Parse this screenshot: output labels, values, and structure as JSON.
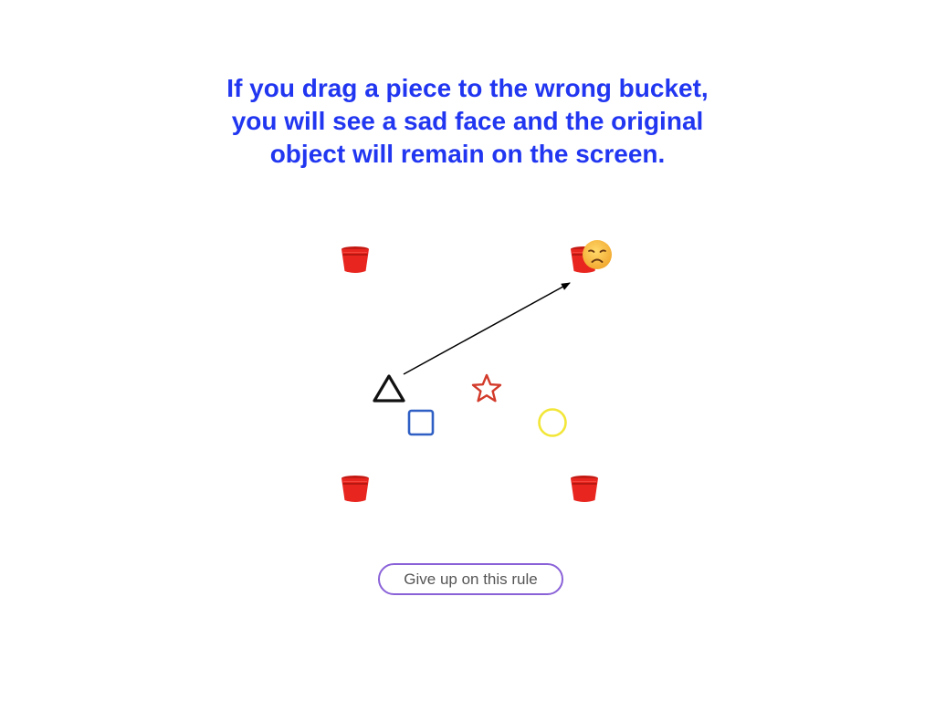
{
  "instruction": {
    "line1": "If you drag a piece to the wrong bucket,",
    "line2": "you will see a sad face and the original",
    "line3": "object will remain on the screen."
  },
  "buckets": [
    {
      "name": "bucket-top-left",
      "icon": "red-bucket-icon"
    },
    {
      "name": "bucket-top-right",
      "icon": "red-bucket-icon"
    },
    {
      "name": "bucket-bottom-left",
      "icon": "red-bucket-icon"
    },
    {
      "name": "bucket-bottom-right",
      "icon": "red-bucket-icon"
    }
  ],
  "feedback": {
    "icon": "sad-face-icon",
    "target_bucket": "bucket-top-right"
  },
  "pieces": [
    {
      "shape": "triangle",
      "color": "#111111"
    },
    {
      "shape": "star",
      "color": "#d23a2a"
    },
    {
      "shape": "square",
      "color": "#2f5fc4"
    },
    {
      "shape": "circle",
      "color": "#f2e637"
    }
  ],
  "drag": {
    "from": "triangle",
    "to": "bucket-top-right",
    "icon": "arrow-icon"
  },
  "colors": {
    "instruction_text": "#2136f0",
    "bucket": "#e8261f",
    "button_border": "#8a62d8",
    "button_text": "#555555"
  },
  "give_up_button": {
    "label": "Give up on this rule"
  }
}
